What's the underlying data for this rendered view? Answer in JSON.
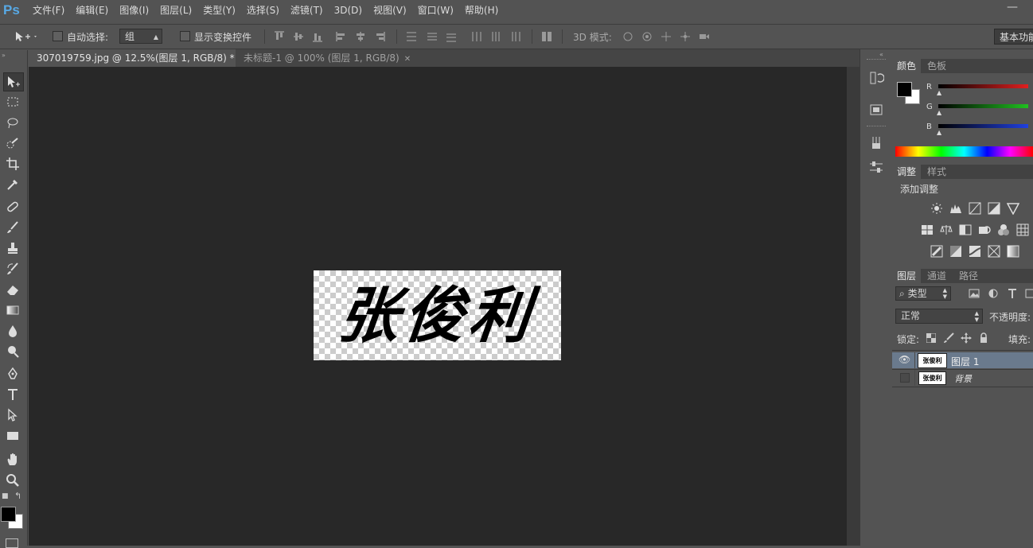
{
  "app": {
    "logo": "Ps",
    "menu": [
      "文件(F)",
      "编辑(E)",
      "图像(I)",
      "图层(L)",
      "类型(Y)",
      "选择(S)",
      "滤镜(T)",
      "3D(D)",
      "视图(V)",
      "窗口(W)",
      "帮助(H)"
    ]
  },
  "options_bar": {
    "auto_select_label": "自动选择:",
    "auto_select_value": "组",
    "show_transform_label": "显示变换控件",
    "mode_3d_label": "3D 模式:",
    "workspace_label": "基本功能"
  },
  "tabs": [
    {
      "label": "307019759.jpg @ 12.5%(图层 1, RGB/8) *",
      "active": true
    },
    {
      "label": "未标题-1 @ 100% (图层 1, RGB/8)",
      "active": false
    }
  ],
  "canvas": {
    "signature_text": "张俊利"
  },
  "color_panel": {
    "tabs": [
      "颜色",
      "色板"
    ],
    "sliders": [
      {
        "label": "R",
        "color": "#e02020"
      },
      {
        "label": "G",
        "color": "#20c020"
      },
      {
        "label": "B",
        "color": "#2040e0"
      }
    ],
    "foreground": "#000000",
    "background": "#ffffff"
  },
  "adjustments_panel": {
    "tabs": [
      "调整",
      "样式"
    ],
    "title": "添加调整"
  },
  "layers_panel": {
    "tabs": [
      "图层",
      "通道",
      "路径"
    ],
    "filter_label": "类型",
    "blend_mode": "正常",
    "opacity_label": "不透明度:",
    "lock_label": "锁定:",
    "fill_label": "填充:",
    "layers": [
      {
        "name": "图层 1",
        "visible": true,
        "selected": true
      },
      {
        "name": "背景",
        "visible": false,
        "selected": false
      }
    ]
  }
}
